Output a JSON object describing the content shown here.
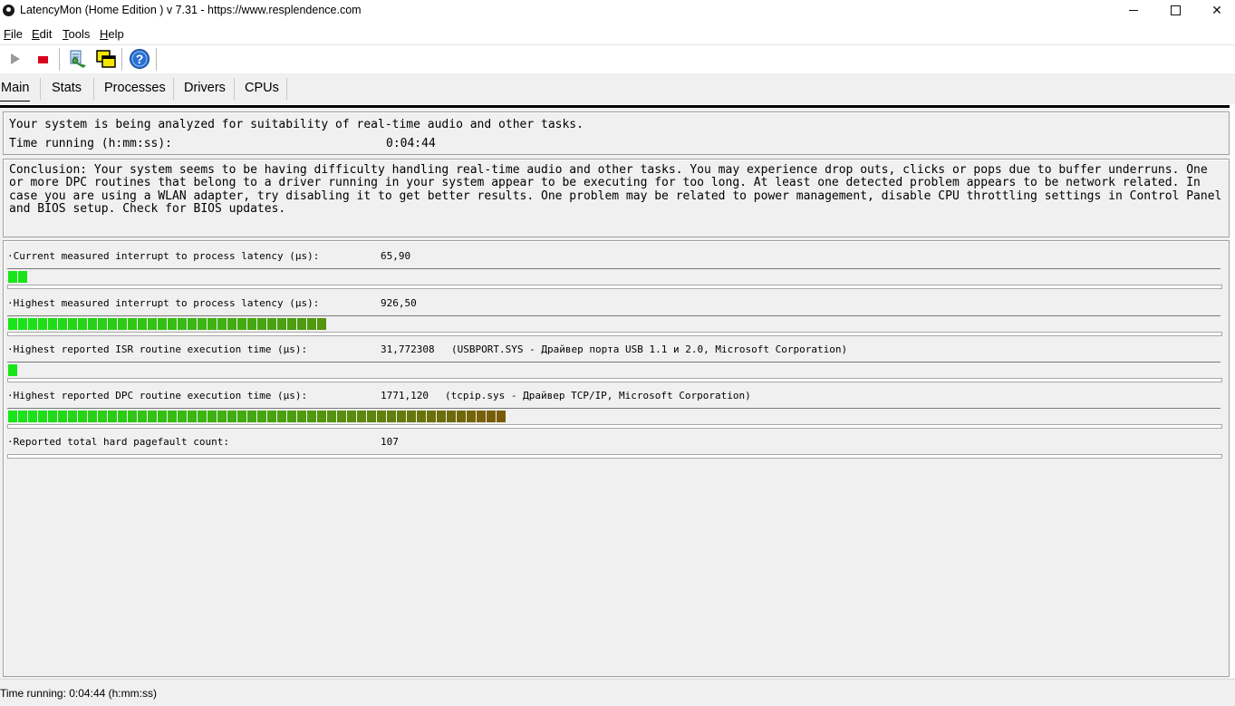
{
  "window": {
    "title": "LatencyMon  (Home Edition )  v 7.31 - https://www.resplendence.com",
    "minimize": "minimize",
    "maximize": "maximize",
    "close": "✕"
  },
  "menu": {
    "items": [
      {
        "label": "File",
        "accel": "F",
        "rest": "ile"
      },
      {
        "label": "Edit",
        "accel": "E",
        "rest": "dit"
      },
      {
        "label": "Tools",
        "accel": "T",
        "rest": "ools"
      },
      {
        "label": "Help",
        "accel": "H",
        "rest": "elp"
      }
    ]
  },
  "toolbar": {
    "icons": [
      "play-icon",
      "stop-icon",
      "report-icon",
      "window-icon",
      "help-icon"
    ]
  },
  "tabs": [
    {
      "label": "Main",
      "active": true
    },
    {
      "label": "Stats",
      "active": false
    },
    {
      "label": "Processes",
      "active": false
    },
    {
      "label": "Drivers",
      "active": false
    },
    {
      "label": "CPUs",
      "active": false
    }
  ],
  "main": {
    "status_line": "Your system is being analyzed for suitability of real-time audio and other tasks.",
    "time_label": "Time running (h:mm:ss):",
    "time_value": "0:04:44",
    "conclusion": "Conclusion: Your system seems to be having difficulty handling real-time audio and other tasks. You may experience drop outs, clicks or pops due to buffer underruns. One or more DPC routines that belong to a driver running in your system appear to be executing for too long. At least one detected problem appears to be network related. In case you are using a WLAN adapter, try disabling it to get better results. One problem may be related to power management, disable CPU throttling settings in Control Panel and BIOS setup. Check for BIOS updates.",
    "metrics": [
      {
        "label": "·Current measured interrupt to process latency (µs):",
        "value": "65,90",
        "extra": "",
        "segments": 2,
        "has_bar": true
      },
      {
        "label": "·Highest measured interrupt to process latency (µs):",
        "value": "926,50",
        "extra": "",
        "segments": 32,
        "has_bar": true
      },
      {
        "label": "·Highest reported ISR routine execution time (µs):",
        "value": "31,772308",
        "extra": "(USBPORT.SYS - Драйвер порта USB 1.1 и 2.0, Microsoft Corporation)",
        "segments": 1,
        "has_bar": true
      },
      {
        "label": "·Highest reported DPC routine execution time (µs):",
        "value": "1771,120",
        "extra": "(tcpip.sys - Драйвер TCP/IP, Microsoft Corporation)",
        "segments": 50,
        "has_bar": true
      },
      {
        "label": "·Reported total hard pagefault count:",
        "value": "107",
        "extra": "",
        "segments": 0,
        "has_bar": false
      }
    ]
  },
  "statusbar": {
    "text": "Time running: 0:04:44  (h:mm:ss)"
  },
  "colors": {
    "bar_start": "#19e619",
    "bar_mid": "#4f9a10",
    "bar_end": "#7a5a06"
  }
}
